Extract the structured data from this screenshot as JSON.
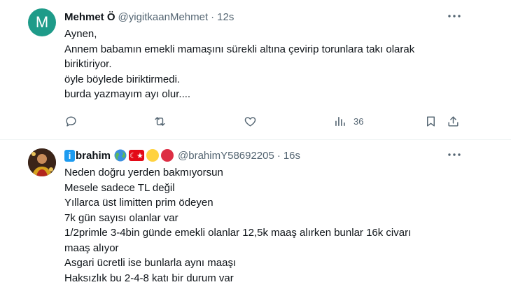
{
  "tweets": [
    {
      "avatar_letter": "M",
      "name": "Mehmet Ö",
      "handle": "@yigitkaanMehmet",
      "separator": "·",
      "time": "12s",
      "lines": [
        "Aynen,",
        "Annem babamın emekli mamaşını sürekli altına çevirip torunlara takı olarak",
        "biriktiriyor.",
        "öyle böylede biriktirmedi.",
        "burda yazmayım ayı olur...."
      ],
      "actions": {
        "reply_icon": "reply-icon",
        "retweet_icon": "retweet-icon",
        "like_icon": "heart-icon",
        "views_icon": "views-icon",
        "views_count": "36",
        "bookmark_icon": "bookmark-icon",
        "share_icon": "share-icon"
      }
    },
    {
      "name_first_letter": "i",
      "name_rest": "brahim",
      "handle": "@brahimY58692205",
      "separator": "·",
      "time": "16s",
      "lines": [
        "Neden doğru yerden bakmıyorsun",
        "Mesele sadece TL değil",
        "Yıllarca üst limitten prim ödeyen",
        "7k gün sayısı olanlar var",
        "1/2primle 3-4bin günde emekli olanlar 12,5k maaş alırken bunlar 16k civarı",
        "maaş alıyor",
        "Asgari ücretli ise bunlarla aynı maaşı",
        "Haksızlık bu 2-4-8 katı bir durum var"
      ]
    }
  ],
  "colors": {
    "avatar_bg": "#1e9b89",
    "secondary_text": "#536471",
    "divider": "#eff3f4",
    "verified_blue": "#1d9bf0"
  }
}
